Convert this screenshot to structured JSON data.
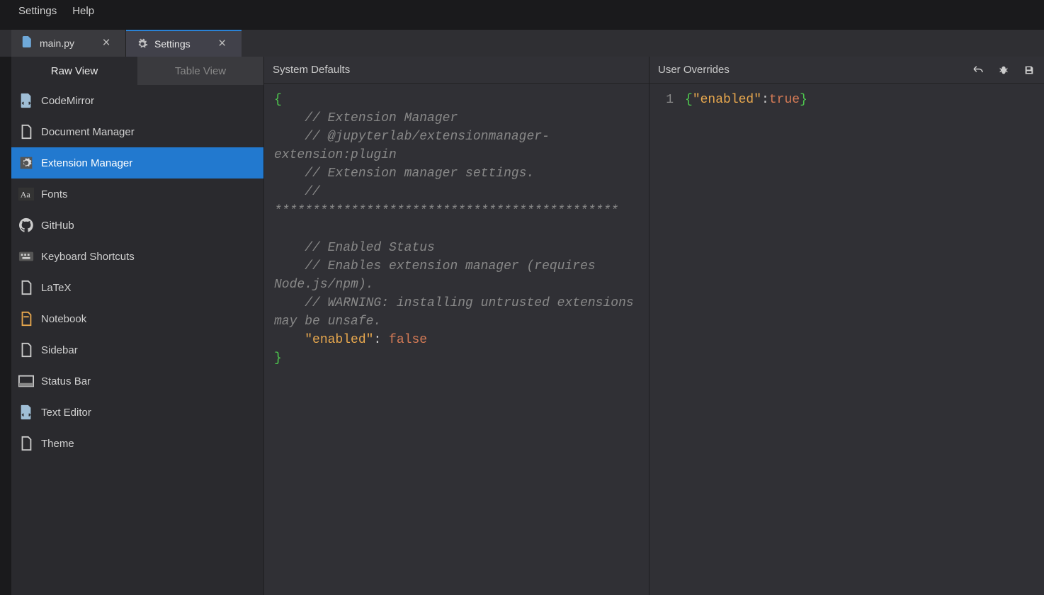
{
  "menubar": {
    "settings": "Settings",
    "help": "Help"
  },
  "tabs": {
    "main": {
      "label": "main.py"
    },
    "settings": {
      "label": "Settings"
    }
  },
  "viewTabs": {
    "raw": "Raw View",
    "table": "Table View"
  },
  "plugins": [
    {
      "id": "codemirror",
      "label": "CodeMirror",
      "icon": "file-code"
    },
    {
      "id": "docmanager",
      "label": "Document Manager",
      "icon": "file"
    },
    {
      "id": "extmanager",
      "label": "Extension Manager",
      "icon": "gear",
      "selected": true
    },
    {
      "id": "fonts",
      "label": "Fonts",
      "icon": "fonts"
    },
    {
      "id": "github",
      "label": "GitHub",
      "icon": "github"
    },
    {
      "id": "keyboard",
      "label": "Keyboard Shortcuts",
      "icon": "keyboard"
    },
    {
      "id": "latex",
      "label": "LaTeX",
      "icon": "file"
    },
    {
      "id": "notebook",
      "label": "Notebook",
      "icon": "notebook"
    },
    {
      "id": "sidebar",
      "label": "Sidebar",
      "icon": "file"
    },
    {
      "id": "statusbar",
      "label": "Status Bar",
      "icon": "statusbar"
    },
    {
      "id": "texteditor",
      "label": "Text Editor",
      "icon": "file-code"
    },
    {
      "id": "theme",
      "label": "Theme",
      "icon": "file"
    }
  ],
  "defaults": {
    "title": "System Defaults",
    "lines": [
      {
        "t": "brace",
        "v": "{"
      },
      {
        "t": "comment",
        "v": "    // Extension Manager"
      },
      {
        "t": "comment",
        "v": "    // @jupyterlab/extensionmanager-extension:plugin"
      },
      {
        "t": "comment",
        "v": "    // Extension manager settings."
      },
      {
        "t": "comment",
        "v": "    // *********************************************"
      },
      {
        "t": "blank",
        "v": ""
      },
      {
        "t": "comment",
        "v": "    // Enabled Status"
      },
      {
        "t": "comment",
        "v": "    // Enables extension manager (requires Node.js/npm)."
      },
      {
        "t": "comment",
        "v": "    // WARNING: installing untrusted extensions may be unsafe."
      },
      {
        "t": "kv",
        "key": "    \"enabled\"",
        "sep": ": ",
        "val": "false"
      },
      {
        "t": "brace",
        "v": "}"
      }
    ]
  },
  "overrides": {
    "title": "User Overrides",
    "lineNum": "1",
    "open": "{",
    "key": "\"enabled\"",
    "sep": ":",
    "val": "true",
    "close": "}"
  }
}
